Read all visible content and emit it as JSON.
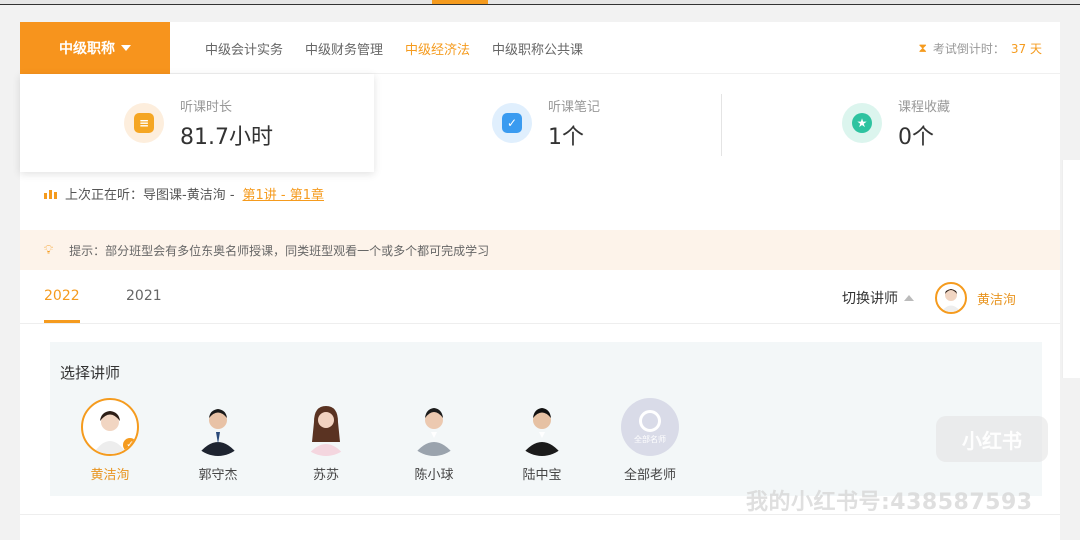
{
  "nav": {
    "dropdown_label": "中级职称",
    "tabs": [
      {
        "label": "中级会计实务",
        "active": false
      },
      {
        "label": "中级财务管理",
        "active": false
      },
      {
        "label": "中级经济法",
        "active": true
      },
      {
        "label": "中级职称公共课",
        "active": false
      }
    ],
    "countdown_label": "考试倒计时：",
    "countdown_value": "37 天"
  },
  "stats": [
    {
      "label": "听课时长",
      "value": "81.7小时",
      "icon": "clock-icon",
      "color": "#f5a623"
    },
    {
      "label": "听课笔记",
      "value": "1个",
      "icon": "note-check-icon",
      "color": "#3a9bf0"
    },
    {
      "label": "课程收藏",
      "value": "0个",
      "icon": "star-icon",
      "color": "#2ec3a0"
    }
  ],
  "last_play": {
    "prefix": "上次正在听：导图课-黄洁洵 -",
    "link": "第1讲 - 第1章"
  },
  "tip": {
    "text": "提示：部分班型会有多位东奥名师授课，同类班型观看一个或多个都可完成学习"
  },
  "years": {
    "items": [
      "2022",
      "2021"
    ],
    "active": "2022"
  },
  "teacher_switch": {
    "label": "切换讲师",
    "current": "黄洁洵"
  },
  "panel": {
    "title": "选择讲师",
    "teachers": [
      {
        "name": "黄洁洵",
        "selected": true
      },
      {
        "name": "郭守杰",
        "selected": false
      },
      {
        "name": "苏苏",
        "selected": false
      },
      {
        "name": "陈小球",
        "selected": false
      },
      {
        "name": "陆中宝",
        "selected": false
      },
      {
        "name": "全部老师",
        "selected": false
      }
    ],
    "all_badge_text": "全部名师"
  },
  "watermark": {
    "badge": "小红书",
    "account": "我的小红书号:438587593"
  }
}
